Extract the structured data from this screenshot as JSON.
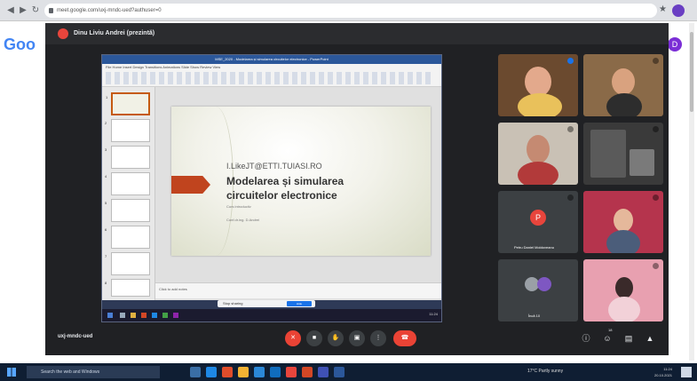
{
  "browser": {
    "url": "meet.google.com/uxj-mndc-ued?authuser=0",
    "back_icon": "arrow-left-icon",
    "forward_icon": "arrow-right-icon",
    "reload_icon": "reload-icon"
  },
  "google": {
    "logo": "Goo",
    "avatar_letter": "D"
  },
  "meet": {
    "window_title": "Dinu Liviu Andrei (prezintă)",
    "meeting_code": "uxj-mndc-ued"
  },
  "ppt": {
    "title_bar": "MSE_2020 - Modelarea și simularea circuitelor electronice - PowerPoint",
    "tabs": "File   Home   Insert   Design   Transitions   Animations   Slide Show   Review   View",
    "notes": "Click to add notes",
    "thumb_numbers": [
      "1",
      "2",
      "3",
      "4",
      "5",
      "6",
      "7",
      "8"
    ],
    "slide": {
      "line1": "I.LikeJT@ETTI.TUIASI.RO",
      "line2": "Modelarea și simularea",
      "line3": "circuitelor electronice",
      "subtitle": "Curs introductiv",
      "author": "Conf.dr.ing. D.Andrei"
    },
    "sharebar_text": "Stop sharing",
    "sharebar_button": "Hide",
    "win_clock": "11:24"
  },
  "participants": [
    {
      "name": ""
    },
    {
      "name": ""
    },
    {
      "name": ""
    },
    {
      "name": ""
    },
    {
      "name": "Petru Daniel Moldoveanu",
      "initial": "P"
    },
    {
      "name": ""
    },
    {
      "name": "Încă 10"
    },
    {
      "name": ""
    }
  ],
  "colors": {
    "meet_bg": "#202124",
    "accent_red": "#ea4335",
    "ppt_blue": "#2b579a",
    "slide_accent": "#c0441e"
  },
  "controls": {
    "mic_icon": "mic-off-icon",
    "camera_icon": "camera-icon",
    "hand_icon": "raise-hand-icon",
    "present_icon": "present-icon",
    "more_icon": "more-options-icon",
    "end_icon": "end-call-icon",
    "info_icon": "info-icon",
    "people_icon": "people-icon",
    "chat_icon": "chat-icon",
    "activities_icon": "activities-icon",
    "people_count": "18"
  },
  "taskbar": {
    "search_placeholder": "Search the web and Windows",
    "weather": "17°C  Partly sunny",
    "time": "11:24",
    "date": "20.10.2021"
  }
}
